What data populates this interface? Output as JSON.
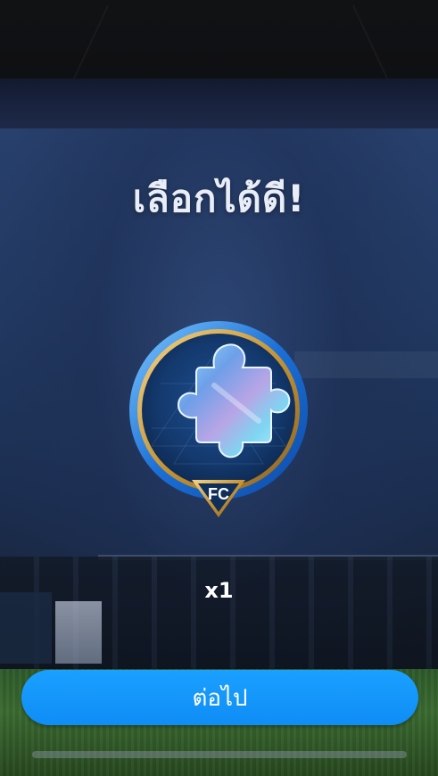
{
  "title": "เลือกได้ดี!",
  "reward": {
    "icon": "puzzle-piece-icon",
    "emblem": "fc-logo",
    "quantity": "x1"
  },
  "continue_label": "ต่อไป",
  "colors": {
    "button": "#1aa0ff",
    "badge_ring": "#1b6fd6",
    "badge_gold": "#d4a94a"
  }
}
